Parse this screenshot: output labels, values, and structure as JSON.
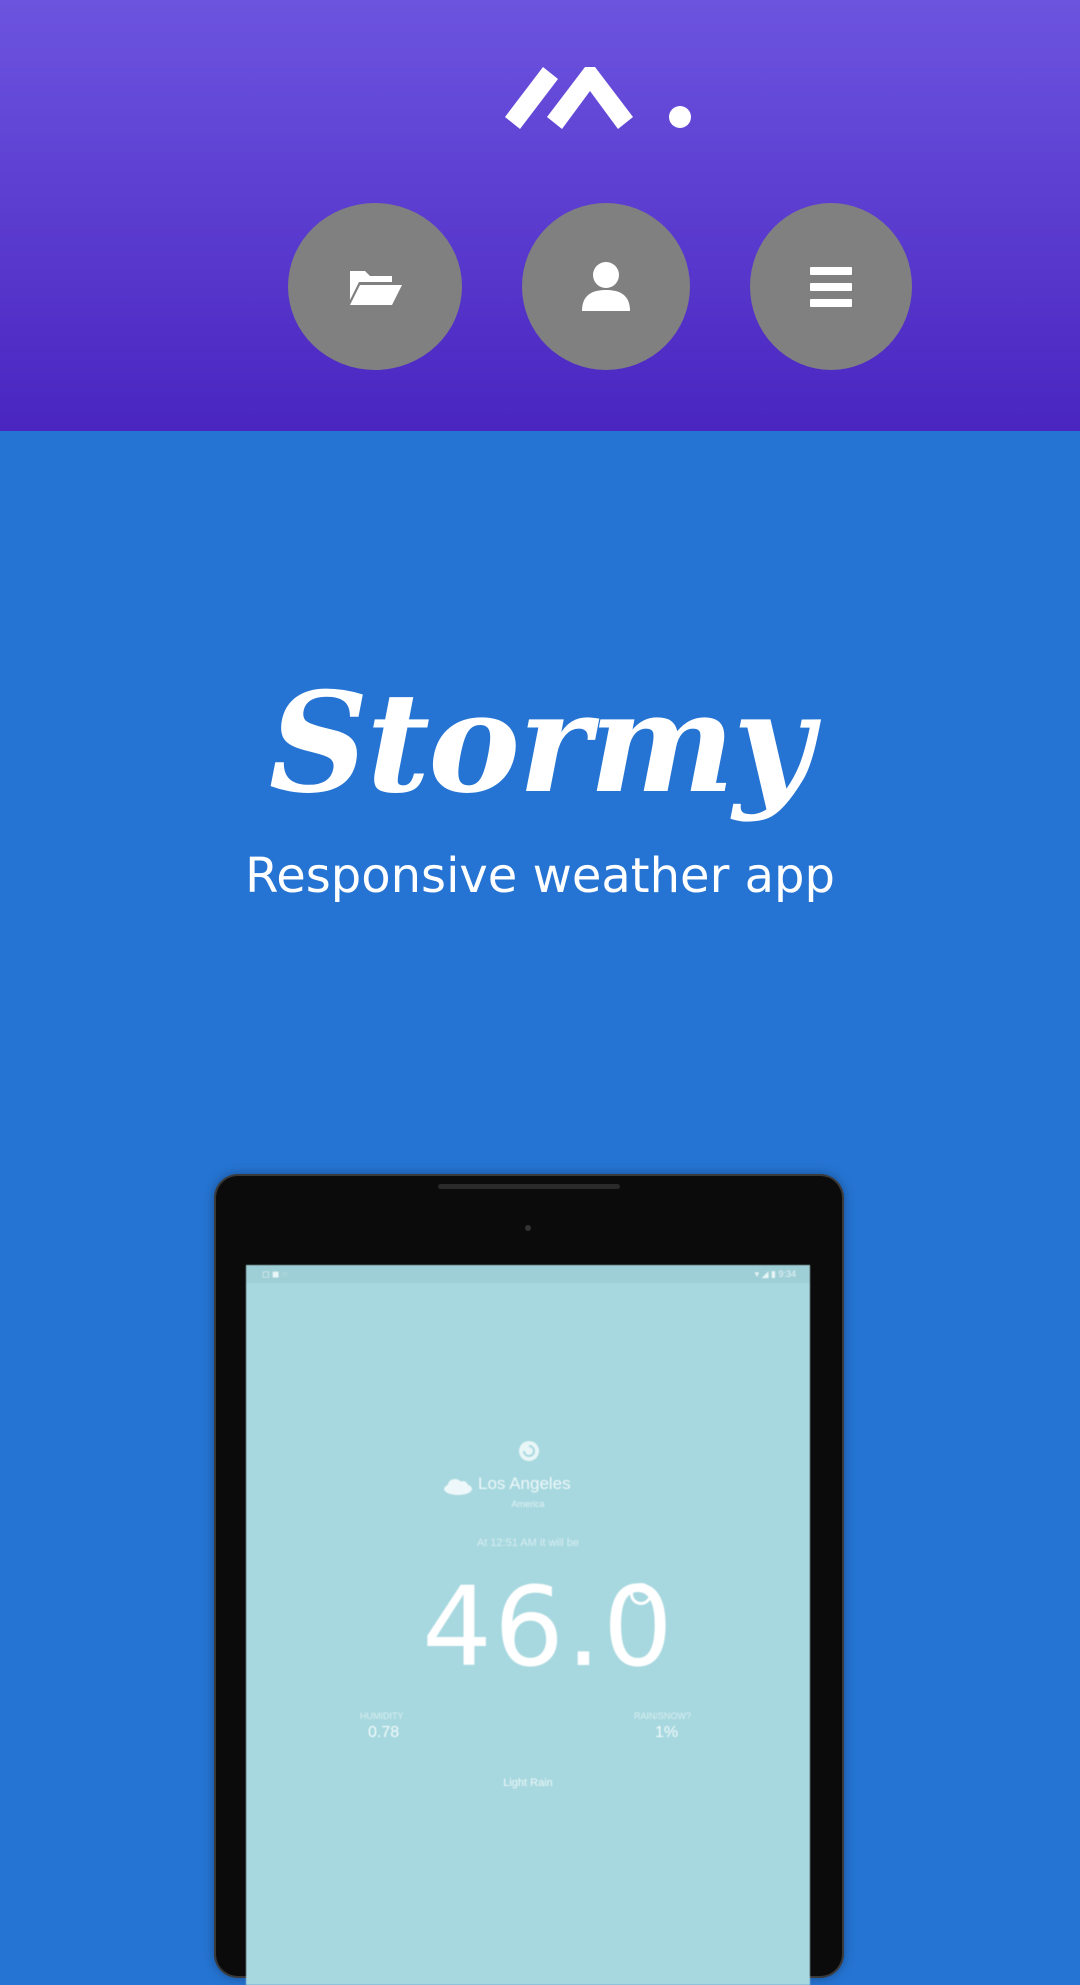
{
  "header": {
    "logo_icon": "brand-logo",
    "nav": [
      {
        "id": "projects",
        "icon": "folder-open-icon"
      },
      {
        "id": "profile",
        "icon": "user-icon"
      },
      {
        "id": "menu",
        "icon": "menu-icon"
      }
    ],
    "colors": {
      "gradient_top": "#6c54df",
      "gradient_bottom": "#4a25c0",
      "nav_button": "#808080"
    }
  },
  "hero": {
    "title": "Stormy",
    "subtitle": "Responsive weather app",
    "background": "#2574d3"
  },
  "device_preview": {
    "status_left": "◻ ◼ ◌",
    "status_right": "▾ ◢ ▮ 9:34",
    "city": "Los Angeles",
    "region": "America",
    "timestamp": "At 12:51 AM it will be",
    "temperature": "46.0",
    "humidity_label": "HUMIDITY",
    "humidity_value": "0.78",
    "rain_label": "RAIN/SNOW?",
    "rain_value": "1%",
    "summary": "Light Rain",
    "screen_color": "#a7d8df"
  }
}
